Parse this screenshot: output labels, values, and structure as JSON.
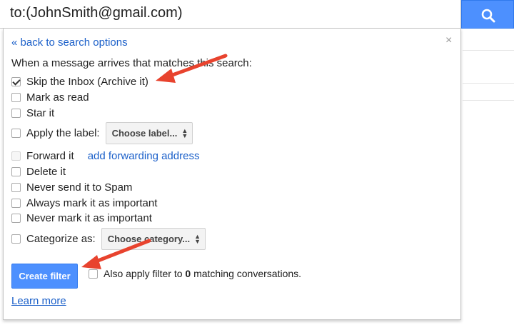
{
  "search": {
    "query": "to:(JohnSmith@gmail.com)"
  },
  "panel": {
    "back_link": "« back to search options",
    "close_symbol": "×",
    "intro": "When a message arrives that matches this search:",
    "options": {
      "skip_inbox": {
        "label": "Skip the Inbox (Archive it)",
        "checked": true
      },
      "mark_read": {
        "label": "Mark as read",
        "checked": false
      },
      "star": {
        "label": "Star it",
        "checked": false
      },
      "apply_label": {
        "label": "Apply the label:",
        "checked": false,
        "select": "Choose label..."
      },
      "forward": {
        "label": "Forward it",
        "checked": false,
        "disabled": true,
        "link": "add forwarding address"
      },
      "delete": {
        "label": "Delete it",
        "checked": false
      },
      "never_spam": {
        "label": "Never send it to Spam",
        "checked": false
      },
      "always_important": {
        "label": "Always mark it as important",
        "checked": false
      },
      "never_important": {
        "label": "Never mark it as important",
        "checked": false
      },
      "categorize": {
        "label": "Categorize as:",
        "checked": false,
        "select": "Choose category..."
      }
    },
    "create_button": "Create filter",
    "also_apply": {
      "prefix": "Also apply filter to ",
      "count": "0",
      "suffix": " matching conversations."
    },
    "learn_more": "Learn more"
  },
  "colors": {
    "accent_blue": "#4d90fe",
    "link_blue": "#1a5fc9",
    "annotation_arrow": "#e8432e"
  },
  "icons": {
    "search_button": "search-icon",
    "close": "close-icon",
    "select_arrows": "updown-chevron-icon",
    "annotation": "red-arrow-annotation"
  }
}
